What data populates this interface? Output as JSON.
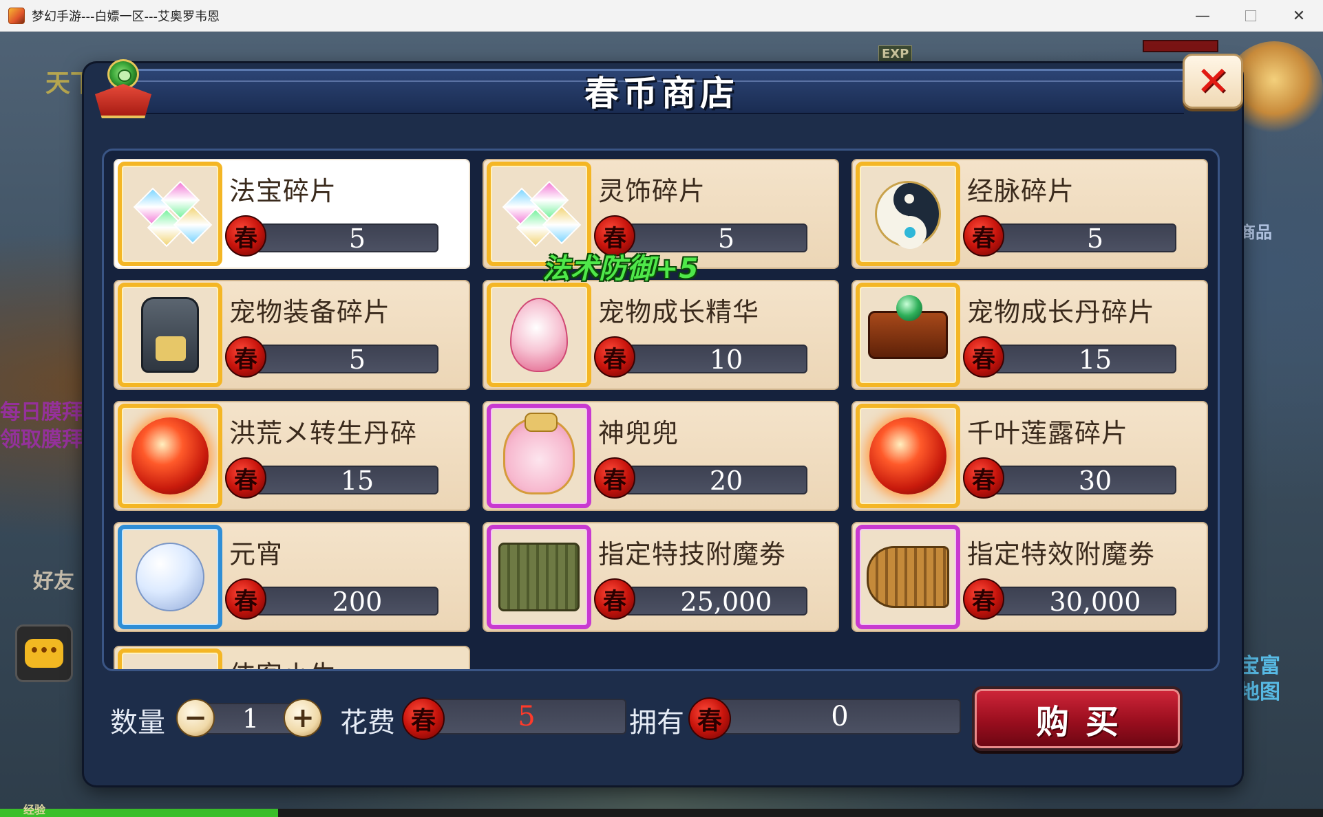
{
  "window": {
    "title": "梦幻手游---白嫖一区---艾奥罗韦恩",
    "minimize": "—",
    "maximize": "",
    "close": "✕"
  },
  "background": {
    "top_left_text": "天下",
    "daily_text_line1": "每日膜拜",
    "daily_text_line2": "领取膜拜",
    "friend_text": "好友",
    "exp_badge": "EXP",
    "shop_text": "商品",
    "map_text_line1": "宝富",
    "map_text_line2": "地图",
    "exp_label": "经验",
    "chat_icon_glyph": "•••",
    "exp_progress_fraction": 0.21
  },
  "shop": {
    "title": "春币商店",
    "close_glyph": "✕",
    "currency_glyph": "春",
    "buff_text": "法术防御+5",
    "items": [
      {
        "name": "法宝碎片",
        "price": "5",
        "icon": "gem-icon",
        "frame": "gold",
        "selected": true
      },
      {
        "name": "灵饰碎片",
        "price": "5",
        "icon": "gem-icon",
        "frame": "gold",
        "selected": false
      },
      {
        "name": "经脉碎片",
        "price": "5",
        "icon": "yinyang-icon",
        "frame": "gold",
        "selected": false
      },
      {
        "name": "宠物装备碎片",
        "price": "5",
        "icon": "armor-icon",
        "frame": "gold",
        "selected": false
      },
      {
        "name": "宠物成长精华",
        "price": "10",
        "icon": "egg-icon",
        "frame": "gold",
        "selected": false
      },
      {
        "name": "宠物成长丹碎片",
        "price": "15",
        "icon": "box-icon",
        "frame": "gold",
        "selected": false
      },
      {
        "name": "洪荒メ转生丹碎",
        "price": "15",
        "icon": "orb-icon",
        "frame": "gold",
        "selected": false
      },
      {
        "name": "神兜兜",
        "price": "20",
        "icon": "pouch-icon",
        "frame": "purple",
        "selected": false
      },
      {
        "name": "千叶莲露碎片",
        "price": "30",
        "icon": "orb-icon",
        "frame": "gold",
        "selected": false
      },
      {
        "name": "元宵",
        "price": "200",
        "icon": "pearl-icon",
        "frame": "blue",
        "selected": false
      },
      {
        "name": "指定特技附魔劵",
        "price": "25,000",
        "icon": "scroll-icon",
        "frame": "purple",
        "selected": false
      },
      {
        "name": "指定特效附魔劵",
        "price": "30,000",
        "icon": "scroll-icon",
        "frame": "purple",
        "selected": false
      }
    ],
    "partial_item_name": "侠客小生",
    "quantity_label": "数量",
    "minus_glyph": "−",
    "plus_glyph": "+",
    "quantity_value": "1",
    "cost_label": "花费",
    "cost_value": "5",
    "own_label": "拥有",
    "own_value": "0",
    "buy_label": "购买"
  }
}
